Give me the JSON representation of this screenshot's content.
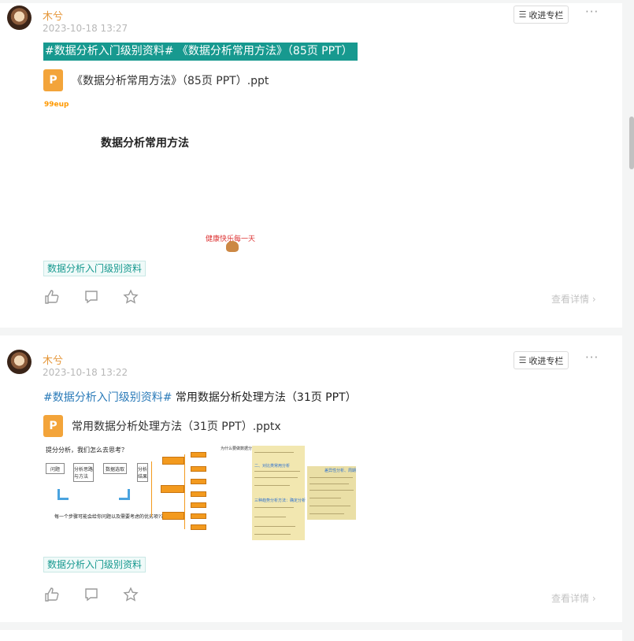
{
  "posts": [
    {
      "author": "木兮",
      "time": "2023-10-18 13:27",
      "collect_label": "收进专栏",
      "more_label": "···",
      "title": "#数据分析入门级别资料# 《数据分析常用方法》（85页 PPT）",
      "file_icon_letter": "P",
      "file_name": "《数据分析常用方法》（85页 PPT）.ppt",
      "preview": {
        "logo_text": "99",
        "logo_text_2": "eup",
        "slide_title": "数据分析常用方法",
        "mascot_text": "健康快乐每一天"
      },
      "topic": "数据分析入门级别资料",
      "detail_label": "查看详情",
      "icons": [
        "thumbs-up-icon",
        "comment-icon",
        "star-icon"
      ]
    },
    {
      "author": "木兮",
      "time": "2023-10-18 13:22",
      "collect_label": "收进专栏",
      "more_label": "···",
      "title_tag": "#数据分析入门级别资料#",
      "title_rest": " 常用数据分析处理方法（31页 PPT）",
      "file_icon_letter": "P",
      "file_name": "常用数据分析处理方法（31页 PPT）.pptx",
      "preview": {
        "slide_a_title": "提分分析，我们怎么去思考？",
        "box_1": "问题",
        "box_2": "分析思路与方法",
        "box_3": "数据选取",
        "box_4": "分析结果",
        "slide_a_foot": "每一个步骤可能会给你问题以及需要考虑的优劣项???",
        "slide_b_title": "为什么要做数据分析?",
        "slide_c_title": "二、对比类常用分析",
        "slide_c_title_2": "三种趋势分析方法：确定分析",
        "slide_d_title": "差异性分析、周期"
      },
      "topic": "数据分析入门级别资料",
      "detail_label": "查看详情",
      "icons": [
        "thumbs-up-icon",
        "comment-icon",
        "star-icon"
      ]
    }
  ],
  "colors": {
    "accent": "#17998f",
    "author": "#e5973a",
    "file_icon": "#f3a43a",
    "tag_link": "#2b7bb9"
  }
}
